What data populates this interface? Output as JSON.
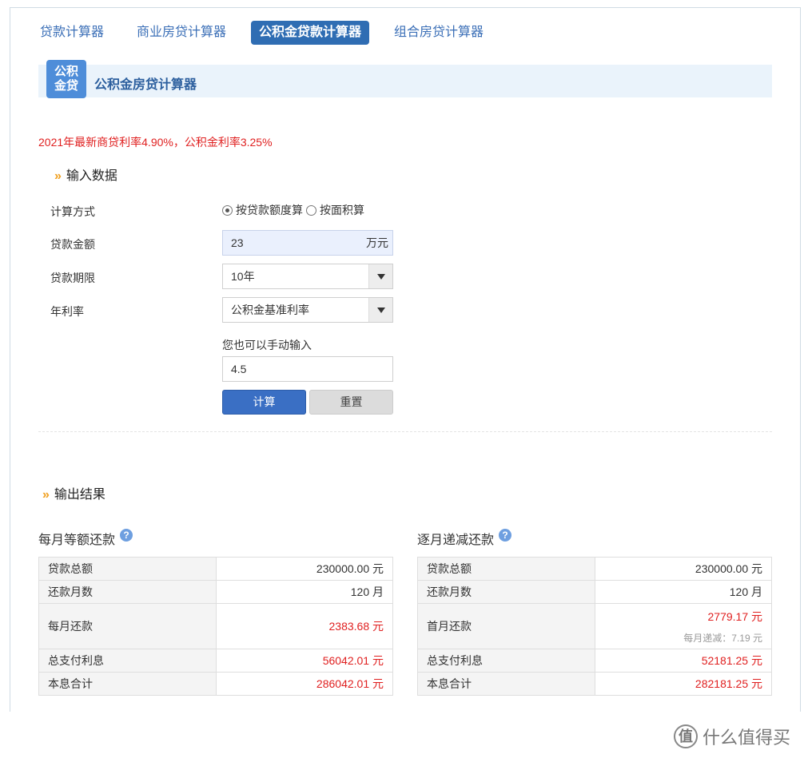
{
  "tabs": [
    {
      "label": "贷款计算器",
      "active": false
    },
    {
      "label": "商业房贷计算器",
      "active": false
    },
    {
      "label": "公积金贷款计算器",
      "active": true
    },
    {
      "label": "组合房贷计算器",
      "active": false
    }
  ],
  "header": {
    "badge": "公积\n金贷",
    "title": "公积金房贷计算器"
  },
  "rate_notice": "2021年最新商贷利率4.90%，公积金利率3.25%",
  "input_section": {
    "title": "输入数据",
    "method_label": "计算方式",
    "method_options": [
      "按贷款额度算",
      "按面积算"
    ],
    "method_selected": "按贷款额度算",
    "amount_label": "贷款金额",
    "amount_value": "23",
    "amount_unit": "万元",
    "term_label": "贷款期限",
    "term_value": "10年",
    "rate_label": "年利率",
    "rate_value": "公积金基准利率",
    "manual_hint": "您也可以手动输入",
    "manual_value": "4.5",
    "calc_button": "计算",
    "reset_button": "重置"
  },
  "output_section": {
    "title": "输出结果",
    "equal_installment": {
      "title": "每月等额还款",
      "rows": [
        {
          "label": "贷款总额",
          "value": "230000.00 元"
        },
        {
          "label": "还款月数",
          "value": "120 月"
        },
        {
          "label": "每月还款",
          "value": "2383.68 元"
        },
        {
          "label": "总支付利息",
          "value": "56042.01 元"
        },
        {
          "label": "本息合计",
          "value": "286042.01 元"
        }
      ]
    },
    "equal_principal": {
      "title": "逐月递减还款",
      "rows": [
        {
          "label": "贷款总额",
          "value": "230000.00 元"
        },
        {
          "label": "还款月数",
          "value": "120 月"
        },
        {
          "label": "首月还款",
          "value": "2779.17 元",
          "sub": "每月递减：7.19 元"
        },
        {
          "label": "总支付利息",
          "value": "52181.25 元"
        },
        {
          "label": "本息合计",
          "value": "282181.25 元"
        }
      ]
    }
  },
  "help_icon": "?",
  "watermark": {
    "logo": "值",
    "text": "什么值得买"
  },
  "colors": {
    "accent": "#2f6db3",
    "red": "#e02020",
    "orange": "#f0a020"
  }
}
